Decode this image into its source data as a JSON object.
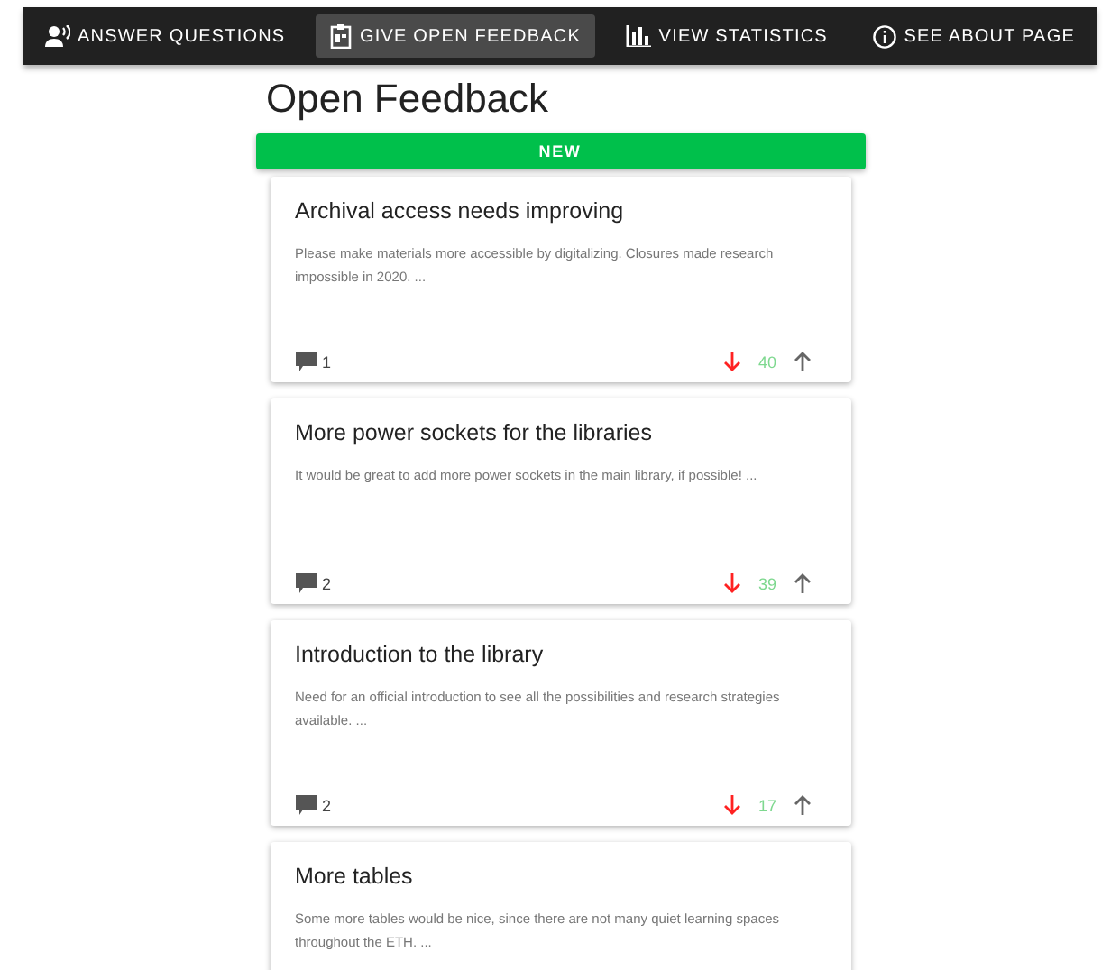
{
  "nav": [
    {
      "kind": "answer",
      "label": "ANSWER QUESTIONS",
      "selected": false
    },
    {
      "kind": "feedback",
      "label": "GIVE OPEN FEEDBACK",
      "selected": true
    },
    {
      "kind": "stats",
      "label": "VIEW STATISTICS",
      "selected": false
    },
    {
      "kind": "about",
      "label": "SEE ABOUT PAGE",
      "selected": false
    }
  ],
  "page_title": "Open Feedback",
  "new_button": "NEW",
  "cards": [
    {
      "title": "Archival access needs improving",
      "body": "Please make materials more accessible by digitalizing. Closures made research impossible in 2020. ...",
      "comments": "1",
      "votes": "40"
    },
    {
      "title": "More power sockets for the libraries",
      "body": "It would be great to add more power sockets in the main library, if possible! ...",
      "comments": "2",
      "votes": "39"
    },
    {
      "title": "Introduction to the library",
      "body": "Need for an official introduction to see all the possibilities and research strategies available. ...",
      "comments": "2",
      "votes": "17"
    },
    {
      "title": "More tables",
      "body": "Some more tables would be nice, since there are not many quiet learning spaces throughout the ETH. ..."
    }
  ]
}
